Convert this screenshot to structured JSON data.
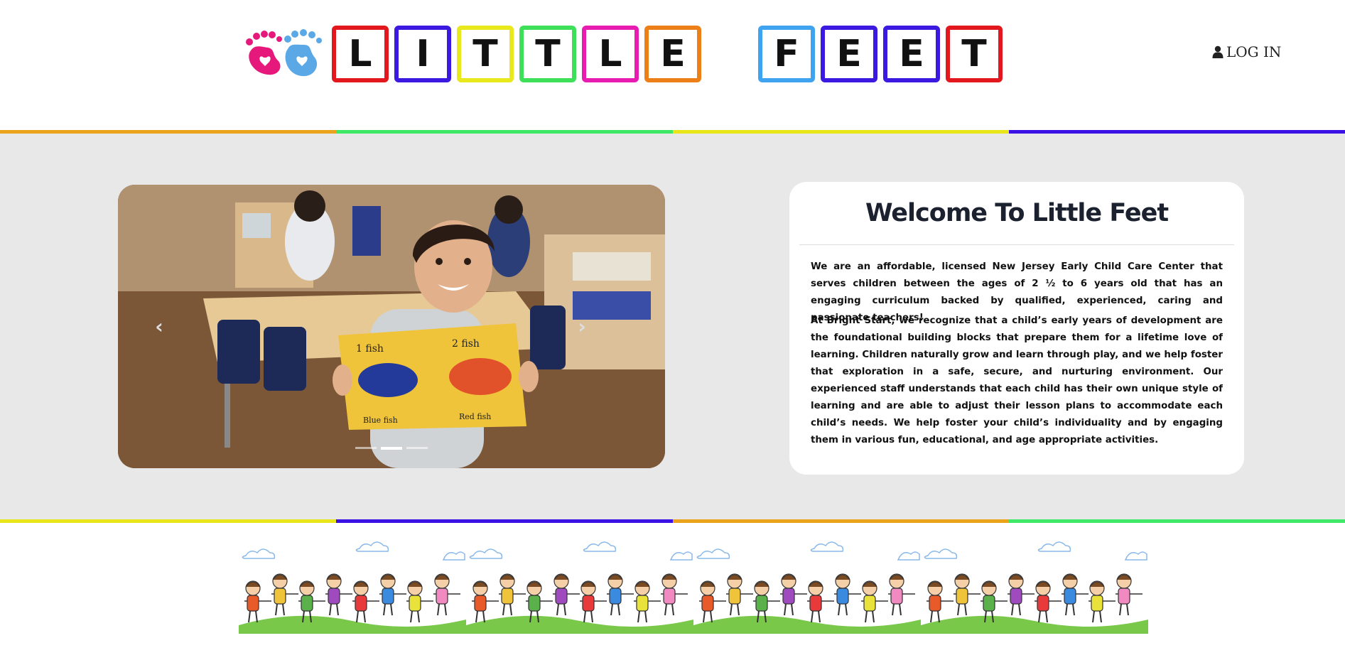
{
  "header": {
    "logo_icon": "baby-feet-icon",
    "logo_letters_word1": [
      "L",
      "I",
      "T",
      "T",
      "L",
      "E"
    ],
    "logo_letters_word2": [
      "F",
      "E",
      "E",
      "T"
    ],
    "logo_tile_colors_word1": [
      "#e3171e",
      "#3c19e0",
      "#e8e81c",
      "#3ee05a",
      "#e81cb0",
      "#ec7f17"
    ],
    "logo_tile_colors_word2": [
      "#3fa3f0",
      "#3c19e0",
      "#3c19e0",
      "#e3171e"
    ],
    "login_icon": "user-icon",
    "login_label": "LOG IN"
  },
  "stripes": {
    "top_colors": [
      "#eaa31a",
      "#3fe866",
      "#e8e61a",
      "#3a12e6"
    ],
    "bottom_colors": [
      "#e8e61a",
      "#3a12e6",
      "#eaa31a",
      "#3fe866"
    ]
  },
  "carousel": {
    "prev_icon": "chevron-left-icon",
    "next_icon": "chevron-right-icon",
    "slide_count": 3,
    "active_slide": 2,
    "slide_image": "smiling-boy-holding-handprint-fish-artwork",
    "artwork_texts": [
      "1 fish",
      "2 fish",
      "Blue fish",
      "Red fish"
    ]
  },
  "welcome": {
    "title": "Welcome To Little Feet",
    "paragraph1": "We are an affordable, licensed New Jersey Early Child Care Center that serves children between the ages of 2 ½ to 6 years old that has an engaging curriculum backed by qualified, experienced, caring and passionate teachers!",
    "paragraph2": "At Bright Start, we recognize that a child’s early years of development are the foundational building blocks that prepare them for a lifetime love of learning. Children naturally grow and learn through play, and we help foster that exploration in a safe, secure, and nurturing environment. Our experienced staff understands that each child has their own unique style of learning and are able to adjust their lesson plans to accommodate each child’s needs. We help foster your child’s individuality and by engaging them in various fun, educational, and age appropriate activities."
  },
  "footer": {
    "banner_image": "children-holding-hands-on-grass-illustration",
    "banner_repeat": 4
  },
  "colors": {
    "hero_background": "#e8e8e8",
    "card_background": "#ffffff",
    "title_color": "#1c2130"
  }
}
